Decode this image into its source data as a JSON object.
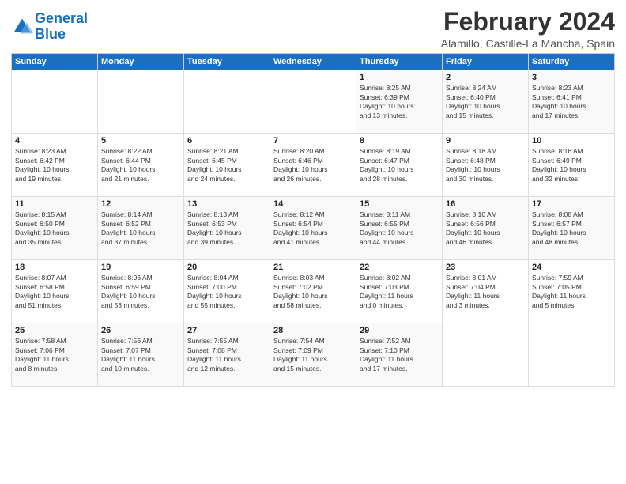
{
  "logo": {
    "line1": "General",
    "line2": "Blue"
  },
  "title": "February 2024",
  "location": "Alamillo, Castille-La Mancha, Spain",
  "days_of_week": [
    "Sunday",
    "Monday",
    "Tuesday",
    "Wednesday",
    "Thursday",
    "Friday",
    "Saturday"
  ],
  "weeks": [
    [
      {
        "day": "",
        "info": ""
      },
      {
        "day": "",
        "info": ""
      },
      {
        "day": "",
        "info": ""
      },
      {
        "day": "",
        "info": ""
      },
      {
        "day": "1",
        "info": "Sunrise: 8:25 AM\nSunset: 6:39 PM\nDaylight: 10 hours\nand 13 minutes."
      },
      {
        "day": "2",
        "info": "Sunrise: 8:24 AM\nSunset: 6:40 PM\nDaylight: 10 hours\nand 15 minutes."
      },
      {
        "day": "3",
        "info": "Sunrise: 8:23 AM\nSunset: 6:41 PM\nDaylight: 10 hours\nand 17 minutes."
      }
    ],
    [
      {
        "day": "4",
        "info": "Sunrise: 8:23 AM\nSunset: 6:42 PM\nDaylight: 10 hours\nand 19 minutes."
      },
      {
        "day": "5",
        "info": "Sunrise: 8:22 AM\nSunset: 6:44 PM\nDaylight: 10 hours\nand 21 minutes."
      },
      {
        "day": "6",
        "info": "Sunrise: 8:21 AM\nSunset: 6:45 PM\nDaylight: 10 hours\nand 24 minutes."
      },
      {
        "day": "7",
        "info": "Sunrise: 8:20 AM\nSunset: 6:46 PM\nDaylight: 10 hours\nand 26 minutes."
      },
      {
        "day": "8",
        "info": "Sunrise: 8:19 AM\nSunset: 6:47 PM\nDaylight: 10 hours\nand 28 minutes."
      },
      {
        "day": "9",
        "info": "Sunrise: 8:18 AM\nSunset: 6:48 PM\nDaylight: 10 hours\nand 30 minutes."
      },
      {
        "day": "10",
        "info": "Sunrise: 8:16 AM\nSunset: 6:49 PM\nDaylight: 10 hours\nand 32 minutes."
      }
    ],
    [
      {
        "day": "11",
        "info": "Sunrise: 8:15 AM\nSunset: 6:50 PM\nDaylight: 10 hours\nand 35 minutes."
      },
      {
        "day": "12",
        "info": "Sunrise: 8:14 AM\nSunset: 6:52 PM\nDaylight: 10 hours\nand 37 minutes."
      },
      {
        "day": "13",
        "info": "Sunrise: 8:13 AM\nSunset: 6:53 PM\nDaylight: 10 hours\nand 39 minutes."
      },
      {
        "day": "14",
        "info": "Sunrise: 8:12 AM\nSunset: 6:54 PM\nDaylight: 10 hours\nand 41 minutes."
      },
      {
        "day": "15",
        "info": "Sunrise: 8:11 AM\nSunset: 6:55 PM\nDaylight: 10 hours\nand 44 minutes."
      },
      {
        "day": "16",
        "info": "Sunrise: 8:10 AM\nSunset: 6:56 PM\nDaylight: 10 hours\nand 46 minutes."
      },
      {
        "day": "17",
        "info": "Sunrise: 8:08 AM\nSunset: 6:57 PM\nDaylight: 10 hours\nand 48 minutes."
      }
    ],
    [
      {
        "day": "18",
        "info": "Sunrise: 8:07 AM\nSunset: 6:58 PM\nDaylight: 10 hours\nand 51 minutes."
      },
      {
        "day": "19",
        "info": "Sunrise: 8:06 AM\nSunset: 6:59 PM\nDaylight: 10 hours\nand 53 minutes."
      },
      {
        "day": "20",
        "info": "Sunrise: 8:04 AM\nSunset: 7:00 PM\nDaylight: 10 hours\nand 55 minutes."
      },
      {
        "day": "21",
        "info": "Sunrise: 8:03 AM\nSunset: 7:02 PM\nDaylight: 10 hours\nand 58 minutes."
      },
      {
        "day": "22",
        "info": "Sunrise: 8:02 AM\nSunset: 7:03 PM\nDaylight: 11 hours\nand 0 minutes."
      },
      {
        "day": "23",
        "info": "Sunrise: 8:01 AM\nSunset: 7:04 PM\nDaylight: 11 hours\nand 3 minutes."
      },
      {
        "day": "24",
        "info": "Sunrise: 7:59 AM\nSunset: 7:05 PM\nDaylight: 11 hours\nand 5 minutes."
      }
    ],
    [
      {
        "day": "25",
        "info": "Sunrise: 7:58 AM\nSunset: 7:06 PM\nDaylight: 11 hours\nand 8 minutes."
      },
      {
        "day": "26",
        "info": "Sunrise: 7:56 AM\nSunset: 7:07 PM\nDaylight: 11 hours\nand 10 minutes."
      },
      {
        "day": "27",
        "info": "Sunrise: 7:55 AM\nSunset: 7:08 PM\nDaylight: 11 hours\nand 12 minutes."
      },
      {
        "day": "28",
        "info": "Sunrise: 7:54 AM\nSunset: 7:09 PM\nDaylight: 11 hours\nand 15 minutes."
      },
      {
        "day": "29",
        "info": "Sunrise: 7:52 AM\nSunset: 7:10 PM\nDaylight: 11 hours\nand 17 minutes."
      },
      {
        "day": "",
        "info": ""
      },
      {
        "day": "",
        "info": ""
      }
    ]
  ]
}
